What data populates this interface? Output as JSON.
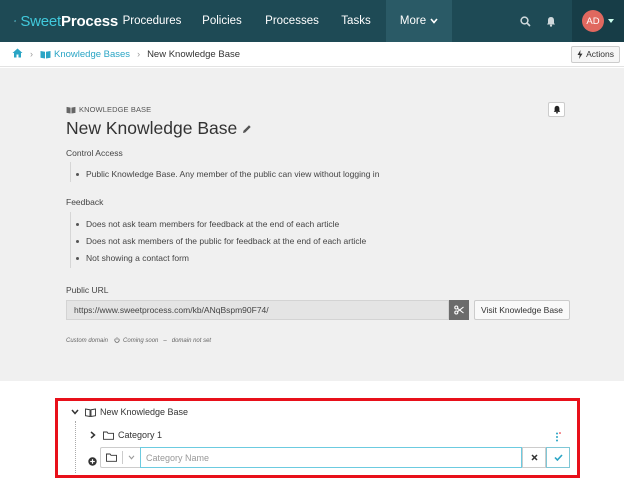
{
  "nav": {
    "logo_sweet": "Sweet",
    "logo_process": "Process",
    "items": [
      {
        "label": "Procedures"
      },
      {
        "label": "Policies"
      },
      {
        "label": "Processes"
      },
      {
        "label": "Tasks"
      },
      {
        "label": "More"
      }
    ],
    "avatar_initials": "AD"
  },
  "breadcrumb": {
    "home_icon": "home-icon",
    "link": "Knowledge Bases",
    "current": "New Knowledge Base",
    "actions_label": "Actions"
  },
  "kb": {
    "label": "KNOWLEDGE BASE",
    "title": "New Knowledge Base",
    "control_access_title": "Control Access",
    "control_access_items": [
      "Public Knowledge Base. Any member of the public can view without logging in"
    ],
    "feedback_title": "Feedback",
    "feedback_items": [
      "Does not ask team members for feedback at the end of each article",
      "Does not ask members of the public for feedback at the end of each article",
      "Not showing a contact form"
    ],
    "public_url_title": "Public URL",
    "public_url_value": "https://www.sweetprocess.com/kb/ANqBspm90F74/",
    "visit_label": "Visit Knowledge Base",
    "custom_domain_label": "Custom domain",
    "coming_soon": "Coming soon",
    "domain_status": "domain not set"
  },
  "tree": {
    "root_label": "New Knowledge Base",
    "category_label": "Category 1",
    "new_category_placeholder": "Category Name",
    "new_category_value": ""
  },
  "colors": {
    "nav_bg": "#1e4a55",
    "accent": "#2aa5c5",
    "highlight_border": "#e8101a",
    "avatar": "#e0685f"
  }
}
